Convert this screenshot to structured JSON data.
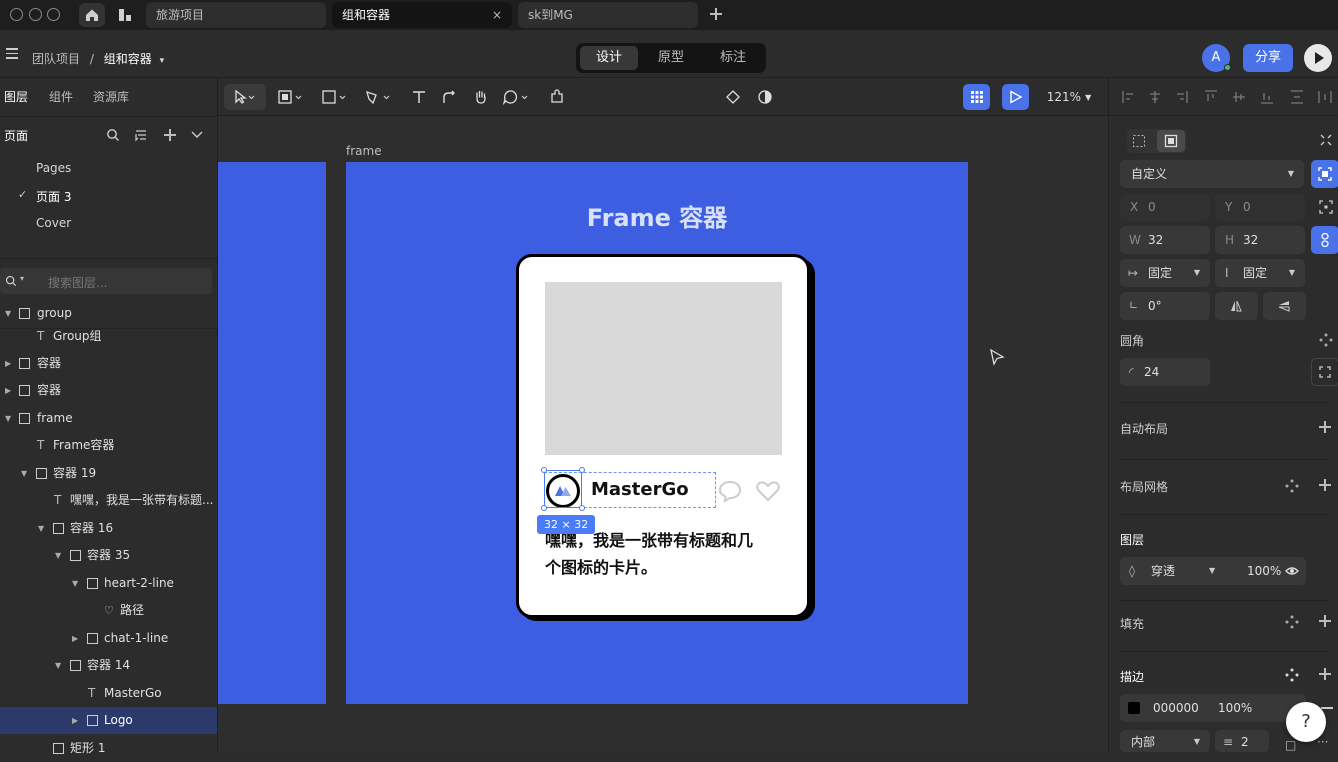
{
  "tabs": [
    {
      "label": "旅游项目"
    },
    {
      "label": "组和容器"
    },
    {
      "label": "sk到MG"
    }
  ],
  "breadcrumb": {
    "team": "团队项目",
    "sep": "/",
    "file": "组和容器"
  },
  "modes": [
    "设计",
    "原型",
    "标注"
  ],
  "user": {
    "avatar": "A"
  },
  "share_label": "分享",
  "zoom": "121%",
  "left_tabs": [
    "图层",
    "组件",
    "资源库"
  ],
  "pages_title": "页面",
  "pages": [
    "Pages",
    "页面 3",
    "Cover"
  ],
  "search_placeholder": "搜索图层...",
  "layers": [
    {
      "name": "group"
    },
    {
      "name": "Group组"
    },
    {
      "name": "容器"
    },
    {
      "name": "容器"
    },
    {
      "name": "frame"
    },
    {
      "name": "Frame容器"
    },
    {
      "name": "容器 19"
    },
    {
      "name": "嘿嘿，我是一张带有标题..."
    },
    {
      "name": "容器 16"
    },
    {
      "name": "容器 35"
    },
    {
      "name": "heart-2-line"
    },
    {
      "name": "路径"
    },
    {
      "name": "chat-1-line"
    },
    {
      "name": "容器 14"
    },
    {
      "name": "MasterGo"
    },
    {
      "name": "Logo"
    },
    {
      "name": "矩形 1"
    }
  ],
  "canvas": {
    "frame_label": "frame",
    "frame_title": "Frame 容器",
    "brand_name": "MasterGo",
    "card_text_line1": "嘿嘿，我是一张带有标题和几",
    "card_text_line2": "个图标的卡片。",
    "size_badge": "32 × 32",
    "colors": {
      "frame": "#3d5ee0",
      "selection": "#4a7cf7",
      "placeholder": "#d9d9d9"
    }
  },
  "props": {
    "preset": "自定义",
    "x_label": "X",
    "x_value": "0",
    "y_label": "Y",
    "y_value": "0",
    "w_label": "W",
    "w_value": "32",
    "h_label": "H",
    "h_value": "32",
    "w_mode": "固定",
    "h_mode": "固定",
    "rotation": "0°",
    "radius_title": "圆角",
    "radius_value": "24",
    "auto_layout": "自动布局",
    "layout_grid": "布局网格",
    "layer_title": "图层",
    "blend": "穿透",
    "opacity": "100%",
    "fill_title": "填充",
    "stroke_title": "描边",
    "stroke_color": "000000",
    "stroke_opacity": "100%",
    "stroke_position": "内部",
    "stroke_width": "2"
  },
  "help_label": "?"
}
